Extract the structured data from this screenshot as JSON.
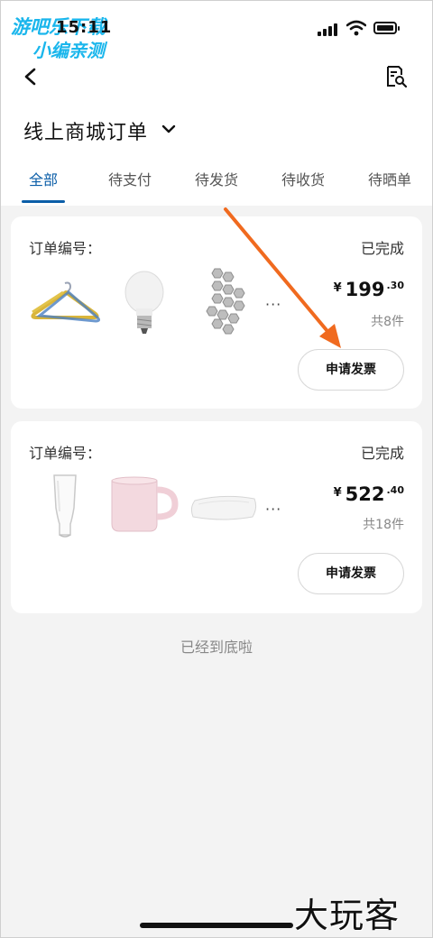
{
  "status_bar": {
    "time": "15:11"
  },
  "watermark": {
    "line1": "游吧乐下载",
    "line2": "小编亲测",
    "bottom": "大玩客"
  },
  "header": {
    "title": "线上商城订单"
  },
  "tabs": [
    {
      "label": "全部",
      "active": true
    },
    {
      "label": "待支付",
      "active": false
    },
    {
      "label": "待发货",
      "active": false
    },
    {
      "label": "待收货",
      "active": false
    },
    {
      "label": "待晒单",
      "active": false
    }
  ],
  "orders": [
    {
      "order_label": "订单编号：",
      "status": "已完成",
      "currency": "¥",
      "price_int": "199",
      "price_dec": ".30",
      "count": "共8件",
      "more": "···",
      "button": "申请发票",
      "items": [
        "clothes-hanger",
        "light-bulb",
        "hexagon-tiles"
      ]
    },
    {
      "order_label": "订单编号：",
      "status": "已完成",
      "currency": "¥",
      "price_int": "522",
      "price_dec": ".40",
      "count": "共18件",
      "more": "···",
      "button": "申请发票",
      "items": [
        "beer-glass",
        "pink-mug",
        "pillow"
      ]
    }
  ],
  "end_text": "已经到底啦",
  "colors": {
    "accent": "#0b5ea8",
    "arrow": "#f06a1f",
    "watermark": "#1ab6ec"
  }
}
